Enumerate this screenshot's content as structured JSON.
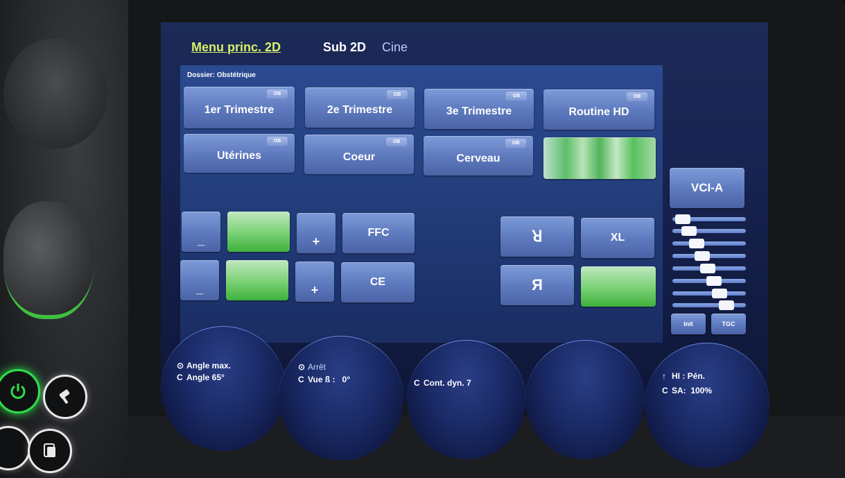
{
  "tabs": [
    {
      "label": "Menu princ. 2D",
      "active": true
    },
    {
      "label": "Sub 2D",
      "active": false
    },
    {
      "label": "Cine",
      "active": false
    }
  ],
  "folder_label": "Dossier: Obstétrique",
  "preset_badge": "OB",
  "presets_row1": [
    "1er Trimestre",
    "2e Trimestre",
    "3e Trimestre",
    "Routine HD"
  ],
  "presets_row2": [
    "Utérines",
    "Coeur",
    "Cerveau"
  ],
  "controls": {
    "minus": "_",
    "plus": "+",
    "ffc": "FFC",
    "ce": "CE",
    "flip_h": "ꓤ",
    "flip_v": "Я",
    "xl": "XL"
  },
  "vci_label": "VCI-A",
  "tgc": {
    "levels": [
      0.05,
      0.15,
      0.28,
      0.38,
      0.48,
      0.58,
      0.68,
      0.8
    ],
    "init_label": "Init",
    "tgc_label": "TGC"
  },
  "dials": [
    {
      "line1_icon": "⊙",
      "line1": "Angle max.",
      "line2_icon": "C",
      "line2": "Angle 65°"
    },
    {
      "line1_icon": "⊙",
      "line1": "Arrêt",
      "line2_icon": "C",
      "line2": "Vue ß :   0°"
    },
    {
      "line1_icon": "",
      "line1": "",
      "line2_icon": "C",
      "line2": "Cont. dyn. 7"
    },
    {
      "line1_icon": "",
      "line1": "",
      "line2_icon": "",
      "line2": ""
    },
    {
      "line1_icon": "↑",
      "line1": "HI : Pén.",
      "line2_icon": "C",
      "line2": "SA:  100%"
    }
  ],
  "colors": {
    "accent_active_tab": "#d6f06a",
    "panel_bg": "#24407e",
    "button": "#5d79bd",
    "green_active": "#5bbf6a",
    "power_led": "#2ee04a"
  },
  "icons": [
    "power-icon",
    "probe-icon",
    "report-icon"
  ]
}
